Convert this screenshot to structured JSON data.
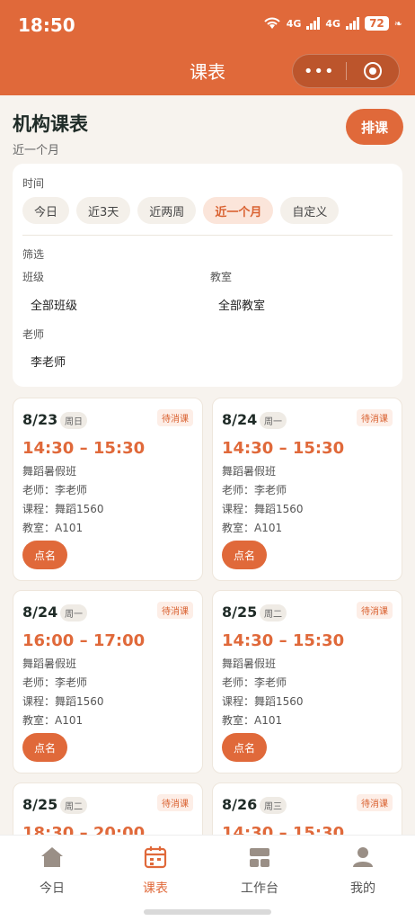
{
  "status": {
    "time": "18:50",
    "battery": "72",
    "net1": "4G",
    "net2": "4G"
  },
  "nav": {
    "title": "课表",
    "more": "•••"
  },
  "header": {
    "title": "机构课表",
    "subtitle": "近一个月",
    "schedule_button": "排课"
  },
  "filters": {
    "time_label": "时间",
    "time_options": [
      "今日",
      "近3天",
      "近两周",
      "近一个月",
      "自定义"
    ],
    "selected_time": "近一个月",
    "filter_label": "筛选",
    "class_label": "班级",
    "class_value": "全部班级",
    "room_label": "教室",
    "room_value": "全部教室",
    "teacher_label": "老师",
    "teacher_value": "李老师"
  },
  "lessons": [
    {
      "date": "8/23",
      "weekday": "周日",
      "status": "待消课",
      "time": "14:30 – 15:30",
      "class": "舞蹈暑假班",
      "teacher": "老师：李老师",
      "course": "课程：舞蹈1560",
      "room": "教室：A101",
      "action": "点名"
    },
    {
      "date": "8/24",
      "weekday": "周一",
      "status": "待消课",
      "time": "14:30 – 15:30",
      "class": "舞蹈暑假班",
      "teacher": "老师：李老师",
      "course": "课程：舞蹈1560",
      "room": "教室：A101",
      "action": "点名"
    },
    {
      "date": "8/24",
      "weekday": "周一",
      "status": "待消课",
      "time": "16:00 – 17:00",
      "class": "舞蹈暑假班",
      "teacher": "老师：李老师",
      "course": "课程：舞蹈1560",
      "room": "教室：A101",
      "action": "点名"
    },
    {
      "date": "8/25",
      "weekday": "周二",
      "status": "待消课",
      "time": "14:30 – 15:30",
      "class": "舞蹈暑假班",
      "teacher": "老师：李老师",
      "course": "课程：舞蹈1560",
      "room": "教室：A101",
      "action": "点名"
    },
    {
      "date": "8/25",
      "weekday": "周二",
      "status": "待消课",
      "time": "18:30 – 20:00",
      "class": "",
      "teacher": "",
      "course": "",
      "room": "",
      "action": ""
    },
    {
      "date": "8/26",
      "weekday": "周三",
      "status": "待消课",
      "time": "14:30 – 15:30",
      "class": "",
      "teacher": "",
      "course": "",
      "room": "",
      "action": ""
    }
  ],
  "tabbar": {
    "items": [
      {
        "label": "今日",
        "icon": "home-icon"
      },
      {
        "label": "课表",
        "icon": "calendar-icon"
      },
      {
        "label": "工作台",
        "icon": "workbench-icon"
      },
      {
        "label": "我的",
        "icon": "user-icon"
      }
    ],
    "active": "课表"
  },
  "colors": {
    "accent": "#e0693a",
    "background": "#f7f3ee"
  }
}
